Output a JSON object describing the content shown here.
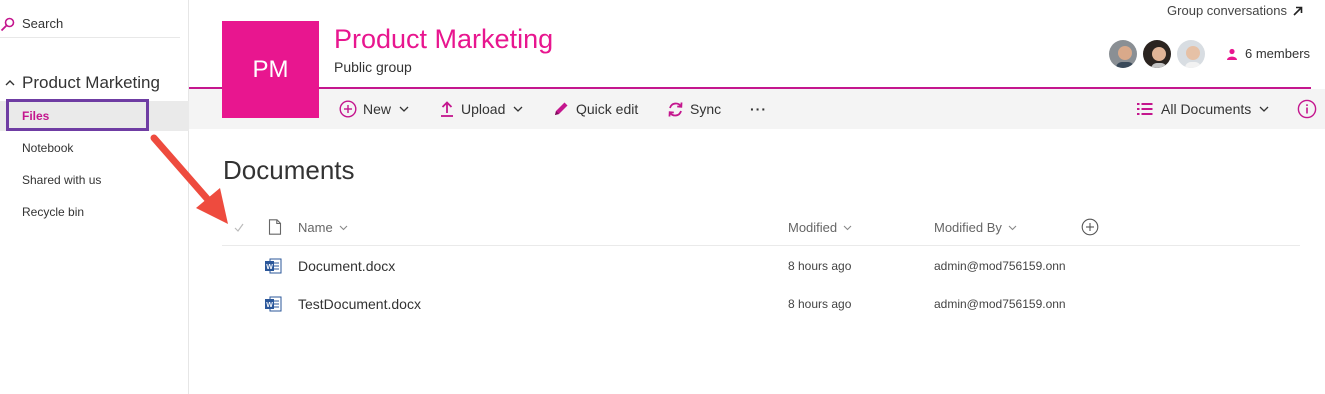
{
  "sidebar": {
    "search_label": "Search",
    "group_name": "Product Marketing",
    "items": [
      {
        "label": "Files",
        "selected": true
      },
      {
        "label": "Notebook",
        "selected": false
      },
      {
        "label": "Shared with us",
        "selected": false
      },
      {
        "label": "Recycle bin",
        "selected": false
      }
    ]
  },
  "header": {
    "tile_initials": "PM",
    "title": "Product Marketing",
    "subtitle": "Public group",
    "conversations_link": "Group conversations",
    "members_count": "6 members",
    "accent_color": "#e8168f"
  },
  "commandbar": {
    "new_label": "New",
    "upload_label": "Upload",
    "quick_edit_label": "Quick edit",
    "sync_label": "Sync",
    "more_label": "···",
    "view_label": "All Documents"
  },
  "documents": {
    "title": "Documents",
    "columns": {
      "name": "Name",
      "modified": "Modified",
      "modified_by": "Modified By"
    },
    "rows": [
      {
        "name": "Document.docx",
        "modified": "8 hours ago",
        "modified_by": "admin@mod756159.onn",
        "icon": "word-doc-icon"
      },
      {
        "name": "TestDocument.docx",
        "modified": "8 hours ago",
        "modified_by": "admin@mod756159.onn",
        "icon": "word-doc-icon"
      }
    ]
  }
}
